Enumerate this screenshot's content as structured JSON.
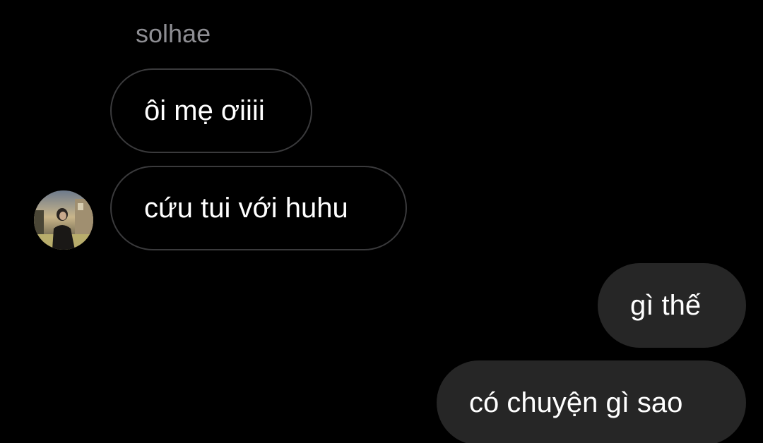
{
  "conversation": {
    "sender_name": "solhae",
    "avatar_icon": "user-photo-avatar",
    "colors": {
      "background": "#000000",
      "incoming_border": "#3a3a3c",
      "outgoing_fill": "#262626",
      "text": "#ffffff",
      "sender_name": "#8e8e93"
    },
    "messages": [
      {
        "direction": "incoming",
        "text": "ôi mẹ ơiiii"
      },
      {
        "direction": "incoming",
        "text": "cứu tui với huhu"
      },
      {
        "direction": "outgoing",
        "text": "gì thế"
      },
      {
        "direction": "outgoing",
        "text": "có chuyện gì sao"
      }
    ]
  }
}
